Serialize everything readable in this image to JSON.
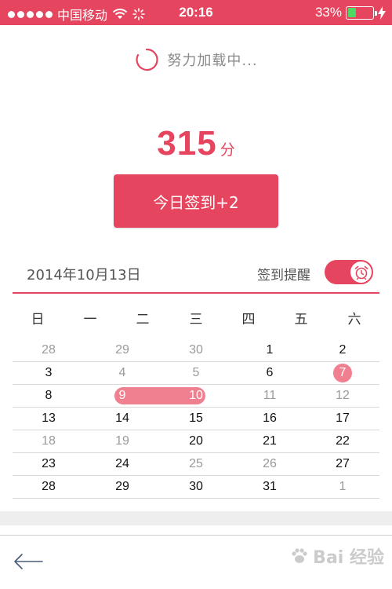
{
  "status_bar": {
    "carrier": "中国移动",
    "time": "20:16",
    "battery_percent": "33%",
    "battery_level": 0.33,
    "icons": [
      "signal-dots-icon",
      "wifi-icon",
      "activity-spinner-icon",
      "battery-icon",
      "charging-bolt-icon"
    ]
  },
  "loading": {
    "text": "努力加载中..."
  },
  "score": {
    "value": "315",
    "unit": "分"
  },
  "checkin_button": {
    "label": "今日签到+2"
  },
  "date_row": {
    "date": "2014年10月13日",
    "reminder_label": "签到提醒",
    "reminder_on": true
  },
  "calendar": {
    "weekdays": [
      "日",
      "一",
      "二",
      "三",
      "四",
      "五",
      "六"
    ],
    "weeks": [
      [
        {
          "d": "28",
          "s": "dim"
        },
        {
          "d": "29",
          "s": "dim"
        },
        {
          "d": "30",
          "s": "dim"
        },
        {
          "d": "1",
          "s": "cur"
        },
        {
          "d": "2",
          "s": "cur"
        }
      ],
      [
        {
          "d": "3",
          "s": "cur"
        },
        {
          "d": "4",
          "s": "dim"
        },
        {
          "d": "5",
          "s": "dim"
        },
        {
          "d": "6",
          "s": "cur"
        },
        {
          "d": "7",
          "s": "circle"
        }
      ],
      [
        {
          "d": "8",
          "s": "cur"
        },
        {
          "d": "9",
          "s": "range"
        },
        {
          "d": "10",
          "s": "range"
        },
        {
          "d": "11",
          "s": "dim"
        },
        {
          "d": "12",
          "s": "dim"
        }
      ],
      [
        {
          "d": "13",
          "s": "cur"
        },
        {
          "d": "14",
          "s": "cur"
        },
        {
          "d": "15",
          "s": "cur"
        },
        {
          "d": "16",
          "s": "cur"
        },
        {
          "d": "17",
          "s": "cur"
        }
      ],
      [
        {
          "d": "18",
          "s": "dim"
        },
        {
          "d": "19",
          "s": "dim"
        },
        {
          "d": "20",
          "s": "cur"
        },
        {
          "d": "21",
          "s": "cur"
        },
        {
          "d": "22",
          "s": "cur"
        }
      ],
      [
        {
          "d": "23",
          "s": "cur"
        },
        {
          "d": "24",
          "s": "cur"
        },
        {
          "d": "25",
          "s": "dim"
        },
        {
          "d": "26",
          "s": "dim"
        },
        {
          "d": "27",
          "s": "cur"
        }
      ],
      [
        {
          "d": "28",
          "s": "cur"
        },
        {
          "d": "29",
          "s": "cur"
        },
        {
          "d": "30",
          "s": "cur"
        },
        {
          "d": "31",
          "s": "cur"
        },
        {
          "d": "1",
          "s": "dim"
        }
      ]
    ]
  },
  "bottom": {
    "back_icon": "back-arrow-icon",
    "watermark": "Bai 经验"
  },
  "colors": {
    "accent": "#e5455e",
    "highlight": "#f08090",
    "dim_text": "#9a9a9a"
  }
}
